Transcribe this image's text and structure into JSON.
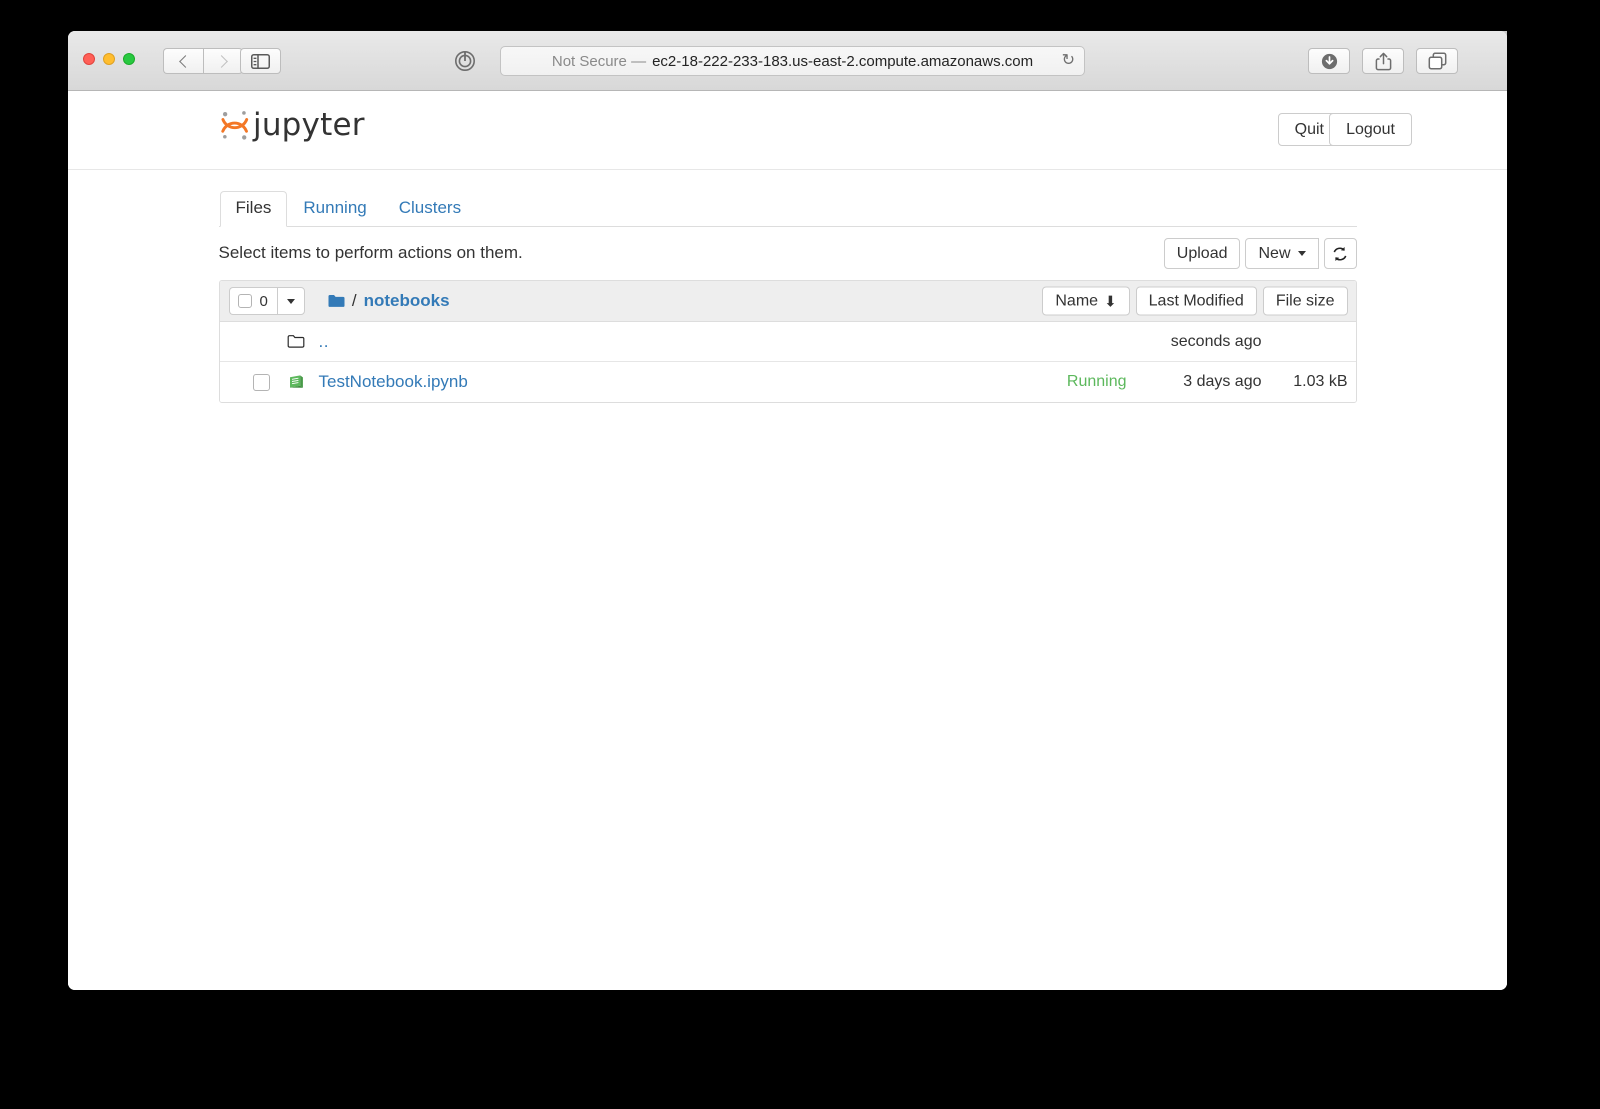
{
  "browser": {
    "back_icon": "chevron-left-icon",
    "forward_icon": "chevron-right-icon",
    "sidebar_icon": "sidebar-toggle-icon",
    "reader_icon": "reader-view-icon",
    "url": {
      "security_label": "Not Secure —",
      "address": "ec2-18-222-233-183.us-east-2.compute.amazonaws.com",
      "reload_icon": "↻"
    },
    "download_icon": "download-icon",
    "share_icon": "share-icon",
    "tabs_icon": "show-tabs-icon",
    "new_tab_label": "+"
  },
  "jupyter": {
    "logo_text": "jupyter",
    "logo_color": "#f37726",
    "quit_label": "Quit",
    "logout_label": "Logout",
    "tabs": [
      {
        "label": "Files",
        "active": true
      },
      {
        "label": "Running",
        "active": false
      },
      {
        "label": "Clusters",
        "active": false
      }
    ],
    "select_hint": "Select items to perform actions on them.",
    "upload_label": "Upload",
    "new_label": "New",
    "refresh_icon": "↻",
    "list_header": {
      "selected_count": "0",
      "breadcrumb_separator": "/",
      "path": "notebooks",
      "folder_icon": "folder-icon",
      "sort_name": "Name",
      "sort_name_arrow": "⬇",
      "sort_modified": "Last Modified",
      "sort_size": "File size"
    },
    "rows": [
      {
        "name": "..",
        "icon": "folder-outline-icon",
        "has_checkbox": false,
        "status": "",
        "modified": "seconds ago",
        "size": ""
      },
      {
        "name": "TestNotebook.ipynb",
        "icon": "notebook-icon",
        "has_checkbox": true,
        "status": "Running",
        "modified": "3 days ago",
        "size": "1.03 kB"
      }
    ]
  }
}
